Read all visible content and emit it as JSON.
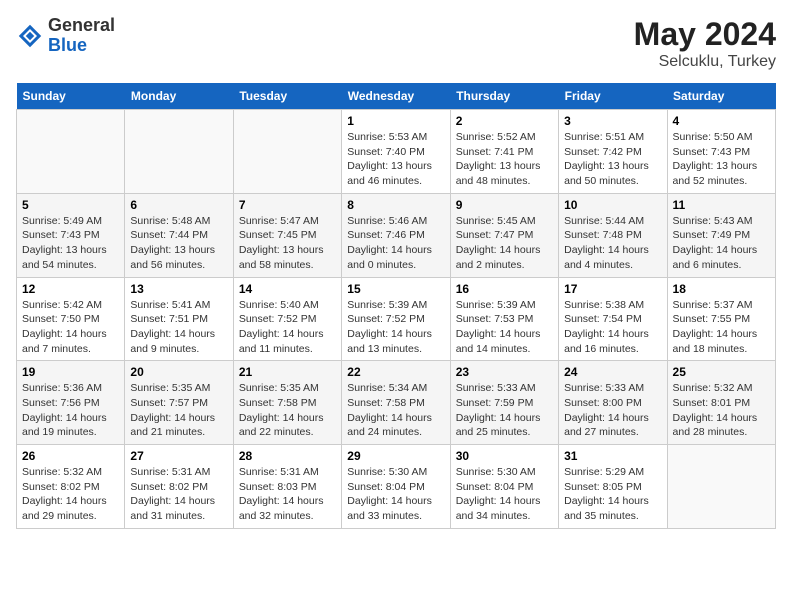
{
  "header": {
    "logo_line1": "General",
    "logo_line2": "Blue",
    "month": "May 2024",
    "location": "Selcuklu, Turkey"
  },
  "weekdays": [
    "Sunday",
    "Monday",
    "Tuesday",
    "Wednesday",
    "Thursday",
    "Friday",
    "Saturday"
  ],
  "weeks": [
    [
      {
        "day": "",
        "info": ""
      },
      {
        "day": "",
        "info": ""
      },
      {
        "day": "",
        "info": ""
      },
      {
        "day": "1",
        "info": "Sunrise: 5:53 AM\nSunset: 7:40 PM\nDaylight: 13 hours\nand 46 minutes."
      },
      {
        "day": "2",
        "info": "Sunrise: 5:52 AM\nSunset: 7:41 PM\nDaylight: 13 hours\nand 48 minutes."
      },
      {
        "day": "3",
        "info": "Sunrise: 5:51 AM\nSunset: 7:42 PM\nDaylight: 13 hours\nand 50 minutes."
      },
      {
        "day": "4",
        "info": "Sunrise: 5:50 AM\nSunset: 7:43 PM\nDaylight: 13 hours\nand 52 minutes."
      }
    ],
    [
      {
        "day": "5",
        "info": "Sunrise: 5:49 AM\nSunset: 7:43 PM\nDaylight: 13 hours\nand 54 minutes."
      },
      {
        "day": "6",
        "info": "Sunrise: 5:48 AM\nSunset: 7:44 PM\nDaylight: 13 hours\nand 56 minutes."
      },
      {
        "day": "7",
        "info": "Sunrise: 5:47 AM\nSunset: 7:45 PM\nDaylight: 13 hours\nand 58 minutes."
      },
      {
        "day": "8",
        "info": "Sunrise: 5:46 AM\nSunset: 7:46 PM\nDaylight: 14 hours\nand 0 minutes."
      },
      {
        "day": "9",
        "info": "Sunrise: 5:45 AM\nSunset: 7:47 PM\nDaylight: 14 hours\nand 2 minutes."
      },
      {
        "day": "10",
        "info": "Sunrise: 5:44 AM\nSunset: 7:48 PM\nDaylight: 14 hours\nand 4 minutes."
      },
      {
        "day": "11",
        "info": "Sunrise: 5:43 AM\nSunset: 7:49 PM\nDaylight: 14 hours\nand 6 minutes."
      }
    ],
    [
      {
        "day": "12",
        "info": "Sunrise: 5:42 AM\nSunset: 7:50 PM\nDaylight: 14 hours\nand 7 minutes."
      },
      {
        "day": "13",
        "info": "Sunrise: 5:41 AM\nSunset: 7:51 PM\nDaylight: 14 hours\nand 9 minutes."
      },
      {
        "day": "14",
        "info": "Sunrise: 5:40 AM\nSunset: 7:52 PM\nDaylight: 14 hours\nand 11 minutes."
      },
      {
        "day": "15",
        "info": "Sunrise: 5:39 AM\nSunset: 7:52 PM\nDaylight: 14 hours\nand 13 minutes."
      },
      {
        "day": "16",
        "info": "Sunrise: 5:39 AM\nSunset: 7:53 PM\nDaylight: 14 hours\nand 14 minutes."
      },
      {
        "day": "17",
        "info": "Sunrise: 5:38 AM\nSunset: 7:54 PM\nDaylight: 14 hours\nand 16 minutes."
      },
      {
        "day": "18",
        "info": "Sunrise: 5:37 AM\nSunset: 7:55 PM\nDaylight: 14 hours\nand 18 minutes."
      }
    ],
    [
      {
        "day": "19",
        "info": "Sunrise: 5:36 AM\nSunset: 7:56 PM\nDaylight: 14 hours\nand 19 minutes."
      },
      {
        "day": "20",
        "info": "Sunrise: 5:35 AM\nSunset: 7:57 PM\nDaylight: 14 hours\nand 21 minutes."
      },
      {
        "day": "21",
        "info": "Sunrise: 5:35 AM\nSunset: 7:58 PM\nDaylight: 14 hours\nand 22 minutes."
      },
      {
        "day": "22",
        "info": "Sunrise: 5:34 AM\nSunset: 7:58 PM\nDaylight: 14 hours\nand 24 minutes."
      },
      {
        "day": "23",
        "info": "Sunrise: 5:33 AM\nSunset: 7:59 PM\nDaylight: 14 hours\nand 25 minutes."
      },
      {
        "day": "24",
        "info": "Sunrise: 5:33 AM\nSunset: 8:00 PM\nDaylight: 14 hours\nand 27 minutes."
      },
      {
        "day": "25",
        "info": "Sunrise: 5:32 AM\nSunset: 8:01 PM\nDaylight: 14 hours\nand 28 minutes."
      }
    ],
    [
      {
        "day": "26",
        "info": "Sunrise: 5:32 AM\nSunset: 8:02 PM\nDaylight: 14 hours\nand 29 minutes."
      },
      {
        "day": "27",
        "info": "Sunrise: 5:31 AM\nSunset: 8:02 PM\nDaylight: 14 hours\nand 31 minutes."
      },
      {
        "day": "28",
        "info": "Sunrise: 5:31 AM\nSunset: 8:03 PM\nDaylight: 14 hours\nand 32 minutes."
      },
      {
        "day": "29",
        "info": "Sunrise: 5:30 AM\nSunset: 8:04 PM\nDaylight: 14 hours\nand 33 minutes."
      },
      {
        "day": "30",
        "info": "Sunrise: 5:30 AM\nSunset: 8:04 PM\nDaylight: 14 hours\nand 34 minutes."
      },
      {
        "day": "31",
        "info": "Sunrise: 5:29 AM\nSunset: 8:05 PM\nDaylight: 14 hours\nand 35 minutes."
      },
      {
        "day": "",
        "info": ""
      }
    ]
  ]
}
